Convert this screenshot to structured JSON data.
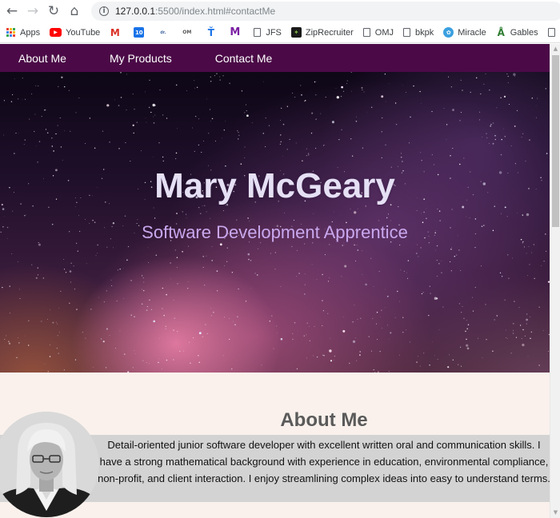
{
  "browser": {
    "url_host": "127.0.0.1",
    "url_rest": ":5500/index.html#contactMe",
    "bookmarks": [
      {
        "label": "Apps",
        "icon": "apps-grid-icon"
      },
      {
        "label": "YouTube",
        "icon": "youtube-icon",
        "color": "#ff0000"
      },
      {
        "label": "",
        "icon": "gmail-icon",
        "color": "#d93025"
      },
      {
        "label": "",
        "icon": "calendar-icon",
        "color": "#1a73e8"
      },
      {
        "label": "",
        "icon": "site-icon",
        "color": "#4a6fa5"
      },
      {
        "label": "",
        "icon": "om-icon",
        "color": "#555555"
      },
      {
        "label": "",
        "icon": "t-icon",
        "color": "#1a73e8"
      },
      {
        "label": "",
        "icon": "m-icon",
        "color": "#7b1fa2"
      },
      {
        "label": "JFS",
        "icon": "page-icon"
      },
      {
        "label": "ZipRecruiter",
        "icon": "ziprecruiter-icon",
        "color": "#1a1a1a"
      },
      {
        "label": "OMJ",
        "icon": "page-icon"
      },
      {
        "label": "bkpk",
        "icon": "page-icon"
      },
      {
        "label": "Miracle",
        "icon": "miracle-icon",
        "color": "#3aa0e0"
      },
      {
        "label": "Gables",
        "icon": "gables-icon",
        "color": "#2e7d32"
      }
    ]
  },
  "nav": {
    "items": [
      "About Me",
      "My Products",
      "Contact Me"
    ]
  },
  "hero": {
    "title": "Mary McGeary",
    "subtitle": "Software Development Apprentice"
  },
  "about": {
    "heading": "About Me",
    "text": "Detail-oriented junior software developer with excellent written oral and communication skills. I have a strong mathematical background with experience in education, environmental compliance, non-profit, and client interaction. I enjoy streamlining complex ideas into easy to understand terms."
  },
  "colors": {
    "nav_bg": "#4b0a47",
    "title": "#e6e0f5",
    "subtitle": "#c9a8ee",
    "page_bg": "#faf1ec",
    "about_band": "#d3d3d3"
  }
}
